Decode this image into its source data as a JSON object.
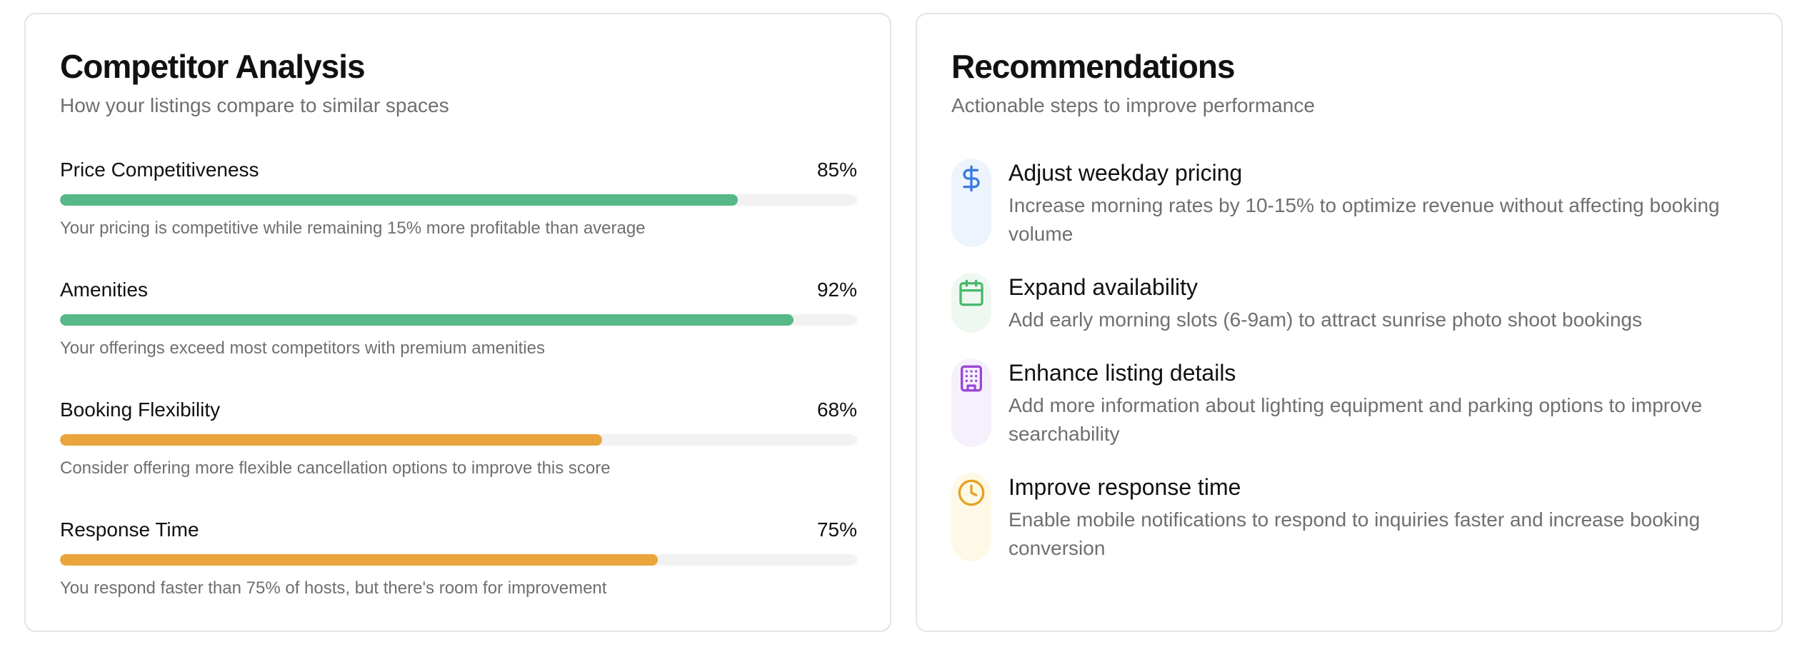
{
  "competitor": {
    "title": "Competitor Analysis",
    "subtitle": "How your listings compare to similar spaces",
    "metrics": [
      {
        "label": "Price Competitiveness",
        "value_text": "85%",
        "value": 85,
        "status": "good",
        "note": "Your pricing is competitive while remaining 15% more profitable than average"
      },
      {
        "label": "Amenities",
        "value_text": "92%",
        "value": 92,
        "status": "good",
        "note": "Your offerings exceed most competitors with premium amenities"
      },
      {
        "label": "Booking Flexibility",
        "value_text": "68%",
        "value": 68,
        "status": "warn",
        "note": "Consider offering more flexible cancellation options to improve this score"
      },
      {
        "label": "Response Time",
        "value_text": "75%",
        "value": 75,
        "status": "warn",
        "note": "You respond faster than 75% of hosts, but there's room for improvement"
      }
    ]
  },
  "recommendations": {
    "title": "Recommendations",
    "subtitle": "Actionable steps to improve performance",
    "items": [
      {
        "icon": "dollar-icon",
        "title": "Adjust weekday pricing",
        "description": "Increase morning rates by 10-15% to optimize revenue without affecting booking volume"
      },
      {
        "icon": "calendar-icon",
        "title": "Expand availability",
        "description": "Add early morning slots (6-9am) to attract sunrise photo shoot bookings"
      },
      {
        "icon": "building-icon",
        "title": "Enhance listing details",
        "description": "Add more information about lighting equipment and parking options to improve searchability"
      },
      {
        "icon": "clock-icon",
        "title": "Improve response time",
        "description": "Enable mobile notifications to respond to inquiries faster and increase booking conversion"
      }
    ]
  },
  "colors": {
    "good": "#56b886",
    "warn": "#eaa43c",
    "blue": "#3b7be0",
    "green": "#4cb86e",
    "purple": "#9a46d8",
    "orange": "#e8a023"
  }
}
